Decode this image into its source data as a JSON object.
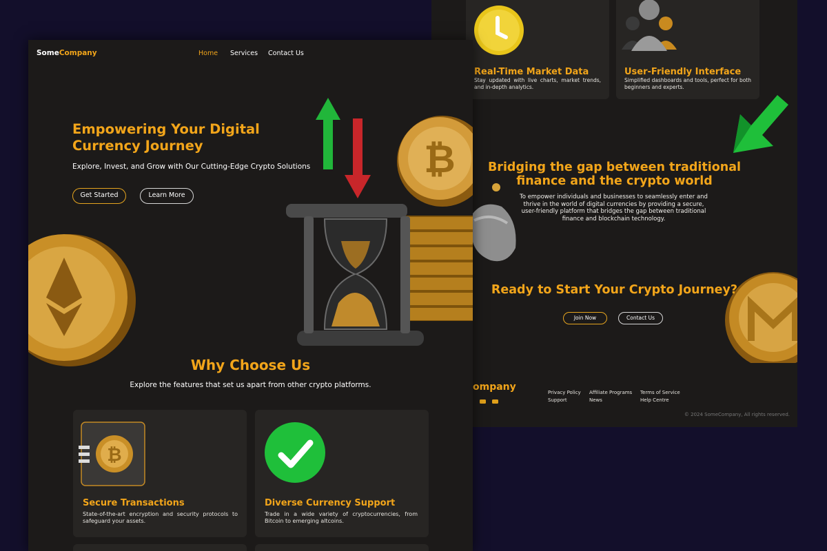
{
  "brand": {
    "some": "Some",
    "company": "Company",
    "footer_partial": "ompany"
  },
  "nav": {
    "home": "Home",
    "services": "Services",
    "contact": "Contact Us"
  },
  "hero": {
    "title_line1": "Empowering Your Digital",
    "title_line2": "Currency Journey",
    "subtitle": "Explore, Invest, and Grow with Our Cutting-Edge Crypto Solutions",
    "primary_button": "Get Started",
    "secondary_button": "Learn More"
  },
  "why": {
    "title": "Why Choose Us",
    "subtitle": "Explore the features that set us apart from other crypto platforms."
  },
  "features": [
    {
      "title": "Secure Transactions",
      "desc": "State-of-the-art encryption and security protocols to safeguard your assets."
    },
    {
      "title": "Diverse Currency Support",
      "desc": "Trade in a wide variety of cryptocurrencies, from Bitcoin to emerging altcoins."
    },
    {
      "title": "Real-Time Market Data",
      "desc": "Stay updated with live charts, market trends, and in-depth analytics."
    },
    {
      "title": "User-Friendly Interface",
      "desc": "Simplified dashboards and tools, perfect for both beginners and experts."
    }
  ],
  "mission": {
    "title_line1": "Bridging the gap between traditional",
    "title_line2": "finance and the crypto world",
    "text": "To empower individuals and businesses to seamlessly enter and thrive in the world of digital currencies by providing a secure, user-friendly platform that bridges the gap between traditional finance and blockchain technology."
  },
  "cta": {
    "title": "Ready to Start Your Crypto Journey?",
    "join": "Join Now",
    "contact": "Contact Us"
  },
  "footer": {
    "links": [
      "Privacy Policy",
      "Support",
      "Affiliate Programs",
      "News",
      "Terms of Service",
      "Help Centre"
    ],
    "copyright": "© 2024 SomeCompany, All rights reserved."
  },
  "colors": {
    "accent": "#f2a51a",
    "background": "#1c1a19",
    "card": "#272523",
    "page_bg": "#130f2b"
  }
}
